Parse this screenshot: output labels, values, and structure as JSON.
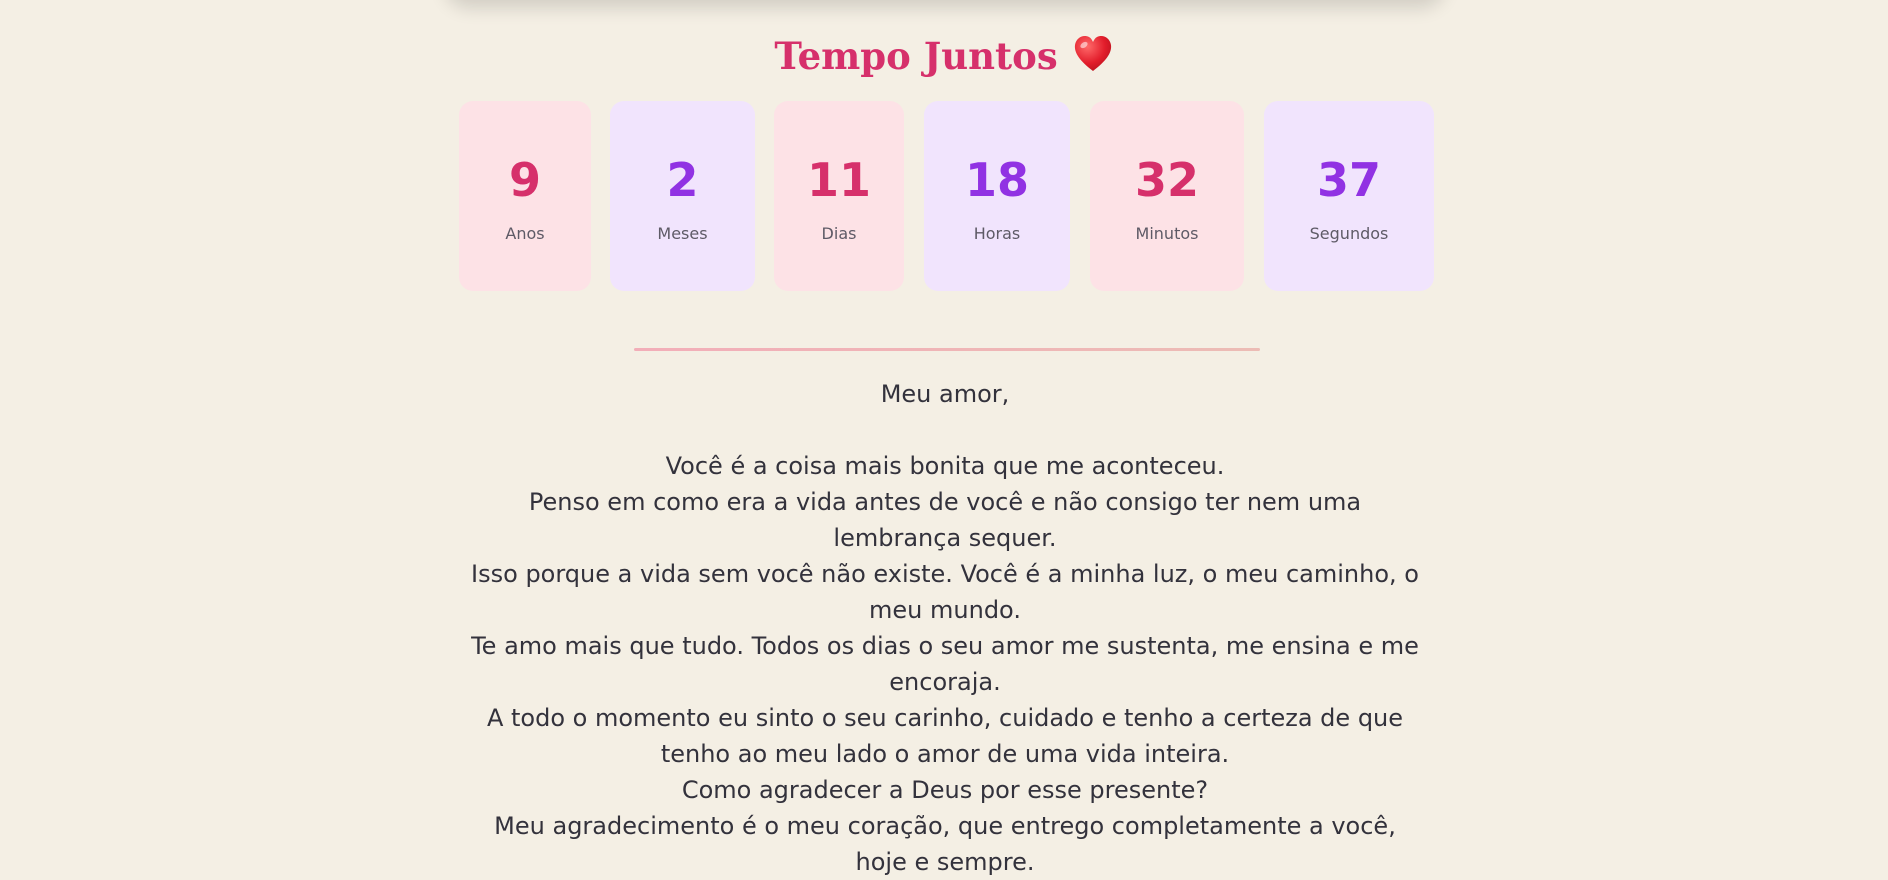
{
  "header": {
    "title": "Tempo Juntos",
    "heart_icon": "heart-icon"
  },
  "counters": [
    {
      "value": "9",
      "label": "Anos"
    },
    {
      "value": "2",
      "label": "Meses"
    },
    {
      "value": "11",
      "label": "Dias"
    },
    {
      "value": "18",
      "label": "Horas"
    },
    {
      "value": "32",
      "label": "Minutos"
    },
    {
      "value": "37",
      "label": "Segundos"
    }
  ],
  "letter": {
    "greeting": "Meu amor,",
    "lines": [
      "Você é a coisa mais bonita que me aconteceu.",
      "Penso em como era a vida antes de você e não consigo ter nem uma lembrança sequer.",
      "Isso porque a vida sem você não existe. Você é a minha luz, o meu caminho, o meu mundo.",
      "Te amo mais que tudo. Todos os dias o seu amor me sustenta, me ensina e me encoraja.",
      "A todo o momento eu sinto o seu carinho, cuidado e tenho a certeza de que tenho ao meu lado o amor de uma vida inteira.",
      "Como agradecer a Deus por esse presente?",
      "Meu agradecimento é o meu coração, que entrego completamente a você, hoje e sempre."
    ]
  },
  "colors": {
    "background": "#f4efe4",
    "accent_pink": "#d6306b",
    "accent_purple": "#9132e3",
    "card_pink": "#fde2e6",
    "card_lilac": "#f1e4fd"
  }
}
